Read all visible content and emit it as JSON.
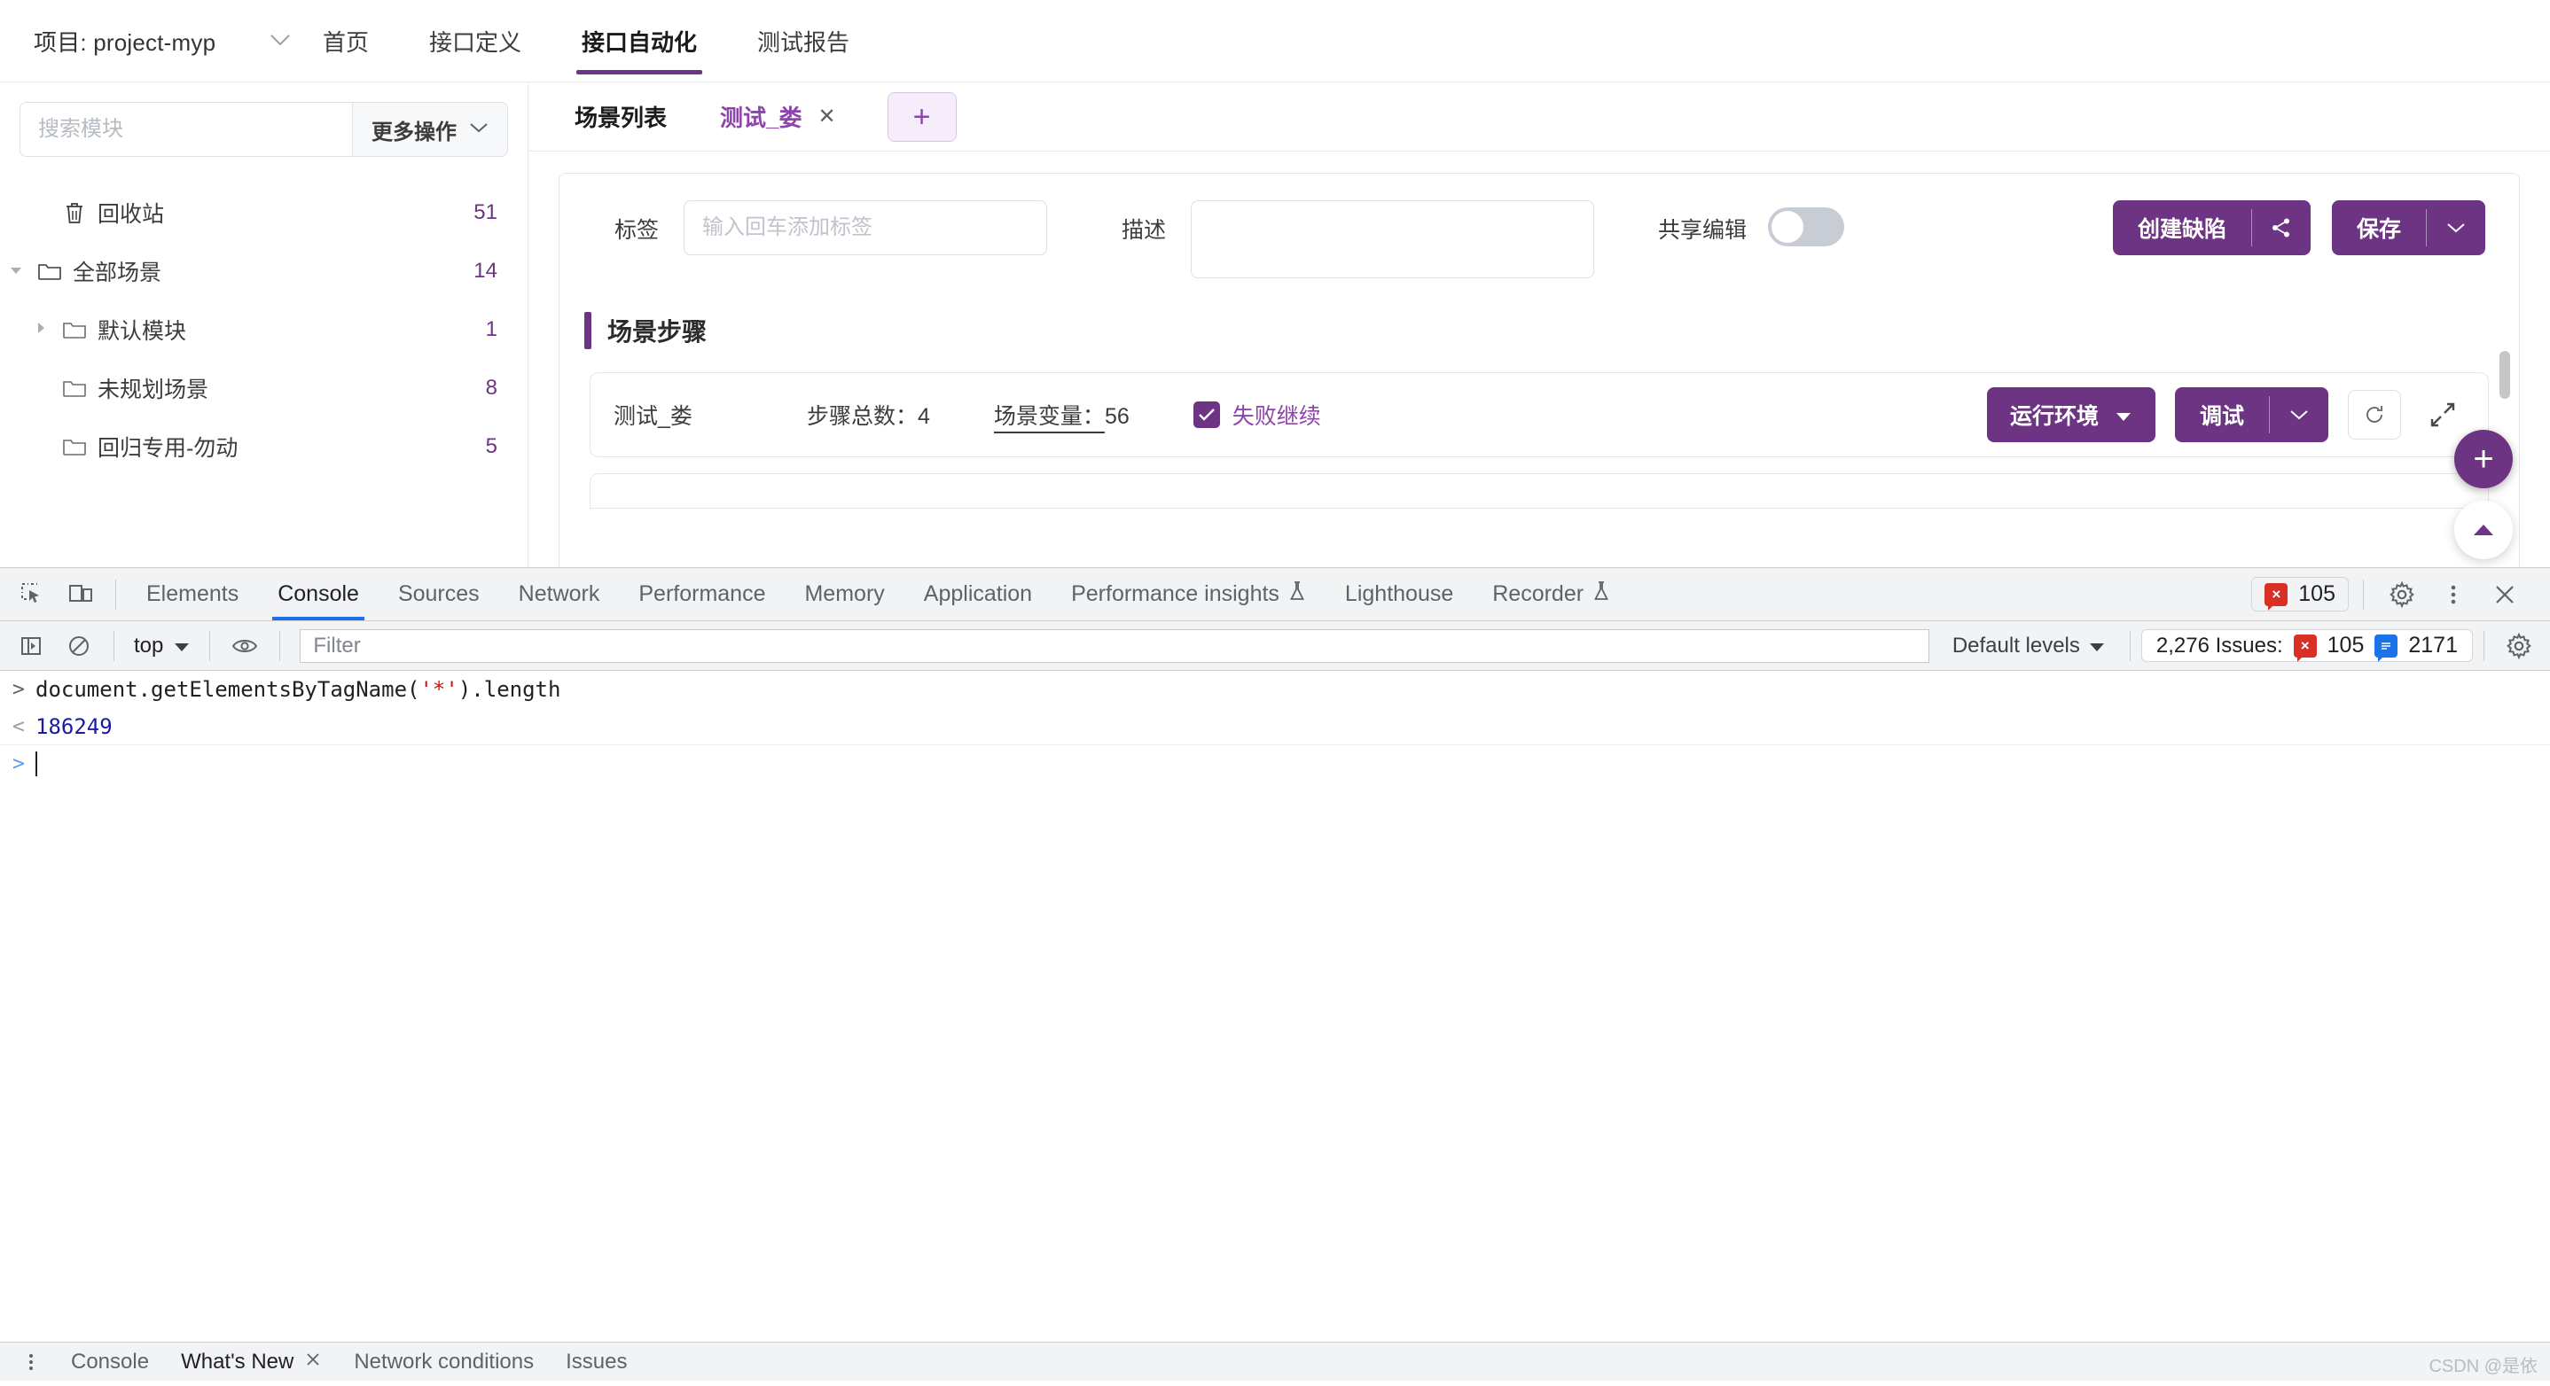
{
  "app": {
    "project": {
      "label": "项目: project-myp",
      "caret_icon": "chevron-down-icon"
    },
    "nav_tabs": [
      {
        "label": "首页",
        "active": false
      },
      {
        "label": "接口定义",
        "active": false
      },
      {
        "label": "接口自动化",
        "active": true
      },
      {
        "label": "测试报告",
        "active": false
      }
    ]
  },
  "sidebar": {
    "search_placeholder": "搜索模块",
    "search_value": "",
    "more_label": "更多操作",
    "tree": [
      {
        "label": "回收站",
        "count": "51",
        "icon": "trash-icon",
        "arrow": "none",
        "indent": 1
      },
      {
        "label": "全部场景",
        "count": "14",
        "icon": "folder-icon",
        "arrow": "open",
        "indent": 0
      },
      {
        "label": "默认模块",
        "count": "1",
        "icon": "folder-icon",
        "arrow": "closed",
        "indent": 1
      },
      {
        "label": "未规划场景",
        "count": "8",
        "icon": "folder-icon",
        "arrow": "none",
        "indent": 2
      },
      {
        "label": "回归专用-勿动",
        "count": "5",
        "icon": "folder-icon",
        "arrow": "none",
        "indent": 2
      }
    ]
  },
  "main": {
    "tabs": [
      {
        "label": "场景列表",
        "active": false,
        "closable": false
      },
      {
        "label": "测试_娄",
        "active": true,
        "closable": true
      }
    ],
    "add_tab_icon": "plus-icon",
    "form": {
      "tag_label": "标签",
      "tag_placeholder": "输入回车添加标签",
      "tag_value": "",
      "desc_label": "描述",
      "desc_value": "",
      "desc_placeholder": "",
      "share_label": "共享编辑",
      "share_enabled": false
    },
    "actions": {
      "create_defect_label": "创建缺陷",
      "share_icon": "share-icon",
      "save_label": "保存",
      "save_caret_icon": "chevron-down-icon"
    },
    "steps_section": {
      "title": "场景步骤",
      "row": {
        "name": "测试_娄",
        "step_count_label": "步骤总数：",
        "step_count_value": "4",
        "variables_label": "场景变量：",
        "variables_value": "56",
        "fail_continue_label": "失败继续",
        "fail_continue_checked": true,
        "env_label": "运行环境",
        "env_caret_icon": "caret-down-icon",
        "debug_label": "调试",
        "debug_caret_icon": "chevron-down-icon",
        "refresh_icon": "refresh-icon",
        "expand_icon": "expand-icon"
      }
    },
    "fab": {
      "add_icon": "plus-icon",
      "scroll_top_icon": "triangle-up-icon"
    }
  },
  "devtools": {
    "toolbar_icons": [
      {
        "name": "inspect-element-icon"
      },
      {
        "name": "device-toolbar-icon"
      }
    ],
    "tabs": [
      {
        "label": "Elements",
        "active": false,
        "badge": ""
      },
      {
        "label": "Console",
        "active": true,
        "badge": ""
      },
      {
        "label": "Sources",
        "active": false,
        "badge": ""
      },
      {
        "label": "Network",
        "active": false,
        "badge": ""
      },
      {
        "label": "Performance",
        "active": false,
        "badge": ""
      },
      {
        "label": "Memory",
        "active": false,
        "badge": ""
      },
      {
        "label": "Application",
        "active": false,
        "badge": ""
      },
      {
        "label": "Performance insights",
        "active": false,
        "badge": "flask-icon"
      },
      {
        "label": "Lighthouse",
        "active": false,
        "badge": ""
      },
      {
        "label": "Recorder",
        "active": false,
        "badge": "flask-icon"
      }
    ],
    "error_pill": {
      "count": "105",
      "icon": "error-badge-icon"
    },
    "settings_icon": "gear-icon",
    "more_icon": "kebab-menu-icon",
    "close_icon": "close-icon",
    "filterbar": {
      "sidebar_toggle_icon": "console-sidebar-icon",
      "clear_icon": "clear-console-icon",
      "context": "top",
      "context_caret_icon": "caret-down-icon",
      "eye_icon": "live-expression-icon",
      "filter_placeholder": "Filter",
      "filter_value": "",
      "levels_label": "Default levels",
      "levels_caret_icon": "caret-down-icon",
      "issues_label": "2,276 Issues:",
      "issues_error_count": "105",
      "issues_info_count": "2171",
      "settings_icon": "gear-icon"
    },
    "console_lines": [
      {
        "type": "input",
        "gutter": ">",
        "code_pre": "document.getElementsByTagName(",
        "code_str": "'*'",
        "code_post": ").length"
      },
      {
        "type": "result",
        "gutter": "<",
        "value": "186249"
      },
      {
        "type": "prompt",
        "gutter": ">",
        "value": ""
      }
    ],
    "drawer": {
      "more_icon": "kebab-menu-icon",
      "tabs": [
        {
          "label": "Console",
          "active": false,
          "closable": false
        },
        {
          "label": "What's New",
          "active": true,
          "closable": true
        },
        {
          "label": "Network conditions",
          "active": false,
          "closable": false
        },
        {
          "label": "Issues",
          "active": false,
          "closable": false
        }
      ]
    },
    "watermark": "CSDN @是依"
  }
}
